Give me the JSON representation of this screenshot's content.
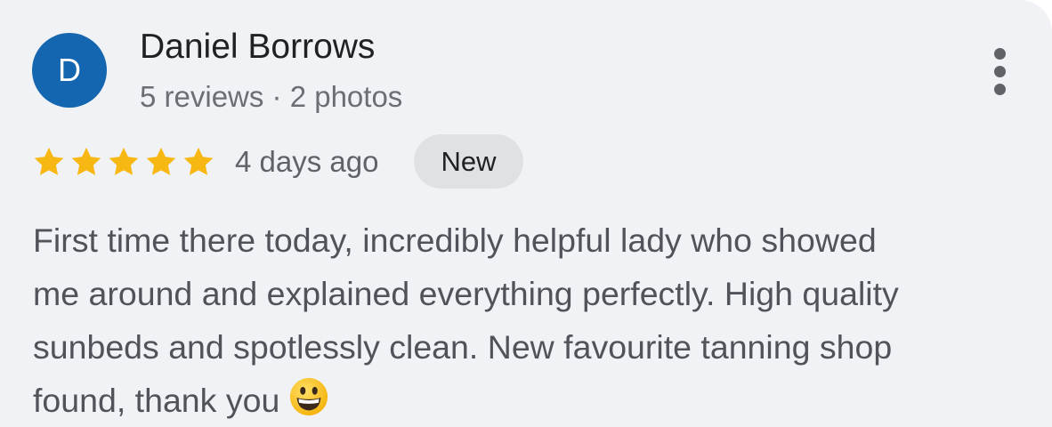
{
  "review": {
    "avatar_initial": "D",
    "reviewer_name": "Daniel Borrows",
    "reviewer_meta": "5 reviews · 2 photos",
    "rating": 5,
    "rating_max": 5,
    "time_ago": "4 days ago",
    "badge": "New",
    "text_lines": [
      "First time there today, incredibly helpful lady who showed",
      "me around and explained everything perfectly. High quality",
      "sunbeds and spotlessly clean. New favourite tanning shop",
      "found, thank you"
    ],
    "emoji": "grinning-face-emoji"
  },
  "icons": {
    "more": "more-vert-icon",
    "star": "star-icon"
  },
  "colors": {
    "card_background": "#f1f2f5",
    "avatar_background": "#1566b0",
    "star": "#f8b814",
    "badge_background": "#e0e1e4"
  }
}
